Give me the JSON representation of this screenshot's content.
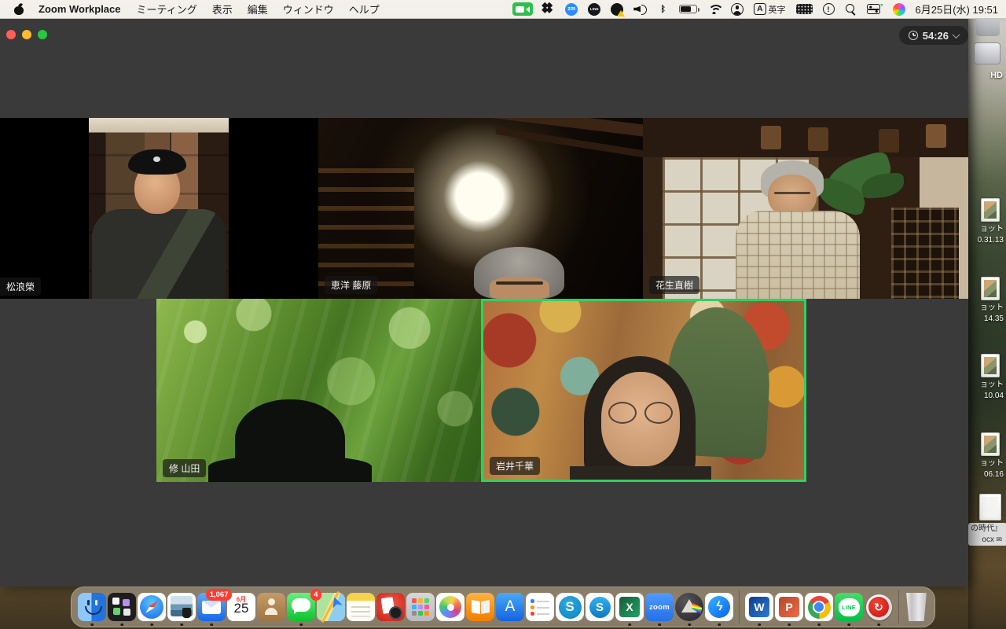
{
  "colors": {
    "active_speaker_border": "#2fd15e",
    "badge_red": "#ff3b30",
    "menu_camera_green": "#2ec04c",
    "dock_month_red": "#ff3b30"
  },
  "menu_bar": {
    "app_name": "Zoom Workplace",
    "menus": [
      "ミーティング",
      "表示",
      "編集",
      "ウィンドウ",
      "ヘルプ"
    ],
    "status_icons": [
      {
        "name": "screen-share-camera"
      },
      {
        "name": "dropbox"
      },
      {
        "name": "zoom-zm",
        "text": "zm"
      },
      {
        "name": "line-app",
        "text": "LINE"
      },
      {
        "name": "notifier-alert"
      },
      {
        "name": "volume"
      },
      {
        "name": "bluetooth",
        "text": "ᛒ"
      },
      {
        "name": "battery"
      },
      {
        "name": "wifi"
      },
      {
        "name": "user-account"
      },
      {
        "name": "input-source",
        "badge": "A",
        "text": "英字"
      },
      {
        "name": "keyboard-viewer"
      },
      {
        "name": "update-alert"
      },
      {
        "name": "spotlight"
      },
      {
        "name": "control-center"
      },
      {
        "name": "siri"
      }
    ],
    "datetime": "6月25日(水) 19:51"
  },
  "zoom_window": {
    "timer": "54:26",
    "active_speaker": "岩井千華",
    "participants": [
      {
        "name": "松浪榮",
        "active": false
      },
      {
        "name": "恵洋 藤原",
        "active": false
      },
      {
        "name": "花生直樹",
        "active": false
      },
      {
        "name": "修 山田",
        "active": false
      },
      {
        "name": "岩井千華",
        "active": true
      }
    ]
  },
  "desktop": {
    "drive_label": "HD",
    "envelope_glyph": "✉",
    "files": [
      {
        "line1": "ョット",
        "line2": "0.31.13",
        "selected": false
      },
      {
        "line1": "ョット",
        "line2": "14.35",
        "selected": false
      },
      {
        "line1": "ョット",
        "line2": "10.04",
        "selected": false
      },
      {
        "line1": "ョット",
        "line2": "06.16",
        "selected": false
      },
      {
        "line1": "の時代』",
        "line2": "ocx",
        "mail_badge": true,
        "selected": true
      }
    ]
  },
  "dock": {
    "icons": [
      {
        "name": "finder",
        "running": true
      },
      {
        "name": "window-manager",
        "running": true
      },
      {
        "name": "safari",
        "running": true
      },
      {
        "name": "preview",
        "running": true
      },
      {
        "name": "mail",
        "badge": "1,067",
        "running": true
      },
      {
        "name": "calendar",
        "month": "6月",
        "day": "25",
        "running": false
      },
      {
        "name": "contacts",
        "running": false
      },
      {
        "name": "messages",
        "badge": "4",
        "running": true
      },
      {
        "name": "maps",
        "running": false
      },
      {
        "name": "notes",
        "running": false
      },
      {
        "name": "photo-booth",
        "running": false
      },
      {
        "name": "launchpad",
        "running": false
      },
      {
        "name": "photos",
        "running": false
      },
      {
        "name": "books",
        "running": false
      },
      {
        "name": "app-store",
        "glyph": "A",
        "running": false
      },
      {
        "name": "reminders",
        "running": false
      },
      {
        "name": "skype-classic",
        "glyph": "S",
        "running": false
      },
      {
        "name": "skype",
        "glyph": "S",
        "running": false
      },
      {
        "name": "excel",
        "glyph": "X",
        "running": true
      },
      {
        "name": "zoom",
        "glyph": "zoom",
        "running": true
      },
      {
        "name": "prism",
        "running": true
      },
      {
        "name": "messenger",
        "glyph": "ϟ",
        "running": true
      },
      {
        "separator": true
      },
      {
        "name": "word",
        "glyph": "W",
        "running": true
      },
      {
        "name": "powerpoint",
        "glyph": "P",
        "running": true
      },
      {
        "name": "chrome",
        "running": true
      },
      {
        "name": "line",
        "glyph": "LINE",
        "running": true
      },
      {
        "name": "trend-micro",
        "glyph": "↻",
        "running": true
      },
      {
        "separator": true
      },
      {
        "name": "trash",
        "running": false
      }
    ]
  }
}
